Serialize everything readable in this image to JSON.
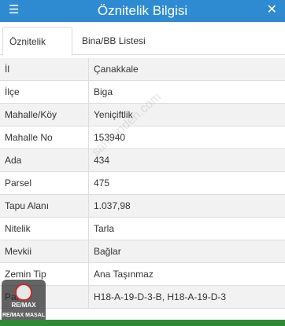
{
  "header": {
    "title": "Öznitelik Bilgisi",
    "left_icon": "list-icon",
    "right_icon": "close-icon",
    "left_glyph": "☰",
    "right_glyph": "✕",
    "background_color": "#2e8bd1"
  },
  "tabs": [
    {
      "label": "Öznitelik Bilgisi",
      "active": true
    },
    {
      "label": "Bina/BB Listesi",
      "active": false
    }
  ],
  "rows": [
    {
      "key": "İl",
      "value": "Çanakkale"
    },
    {
      "key": "İlçe",
      "value": "Biga"
    },
    {
      "key": "Mahalle/Köy",
      "value": "Yeniçiftlik"
    },
    {
      "key": "Mahalle No",
      "value": "153940"
    },
    {
      "key": "Ada",
      "value": "434"
    },
    {
      "key": "Parsel",
      "value": "475"
    },
    {
      "key": "Tapu Alanı",
      "value": "1.037,98"
    },
    {
      "key": "Nitelik",
      "value": "Tarla"
    },
    {
      "key": "Mevkii",
      "value": "Bağlar"
    },
    {
      "key": "Zemin Tip",
      "value": "Ana Taşınmaz"
    },
    {
      "key": "Pafta",
      "value": "H18-A-19-D-3-B, H18-A-19-D-3"
    }
  ],
  "watermark": "sahibinden.com",
  "logo": {
    "brand": "RE/MAX",
    "office": "RE/MAX MASAL"
  },
  "colors": {
    "accent": "#2e8bd1",
    "stripe": "#f2f2f2",
    "bottom_bar": "#2e8b35",
    "logo_red": "#c92a2a"
  }
}
